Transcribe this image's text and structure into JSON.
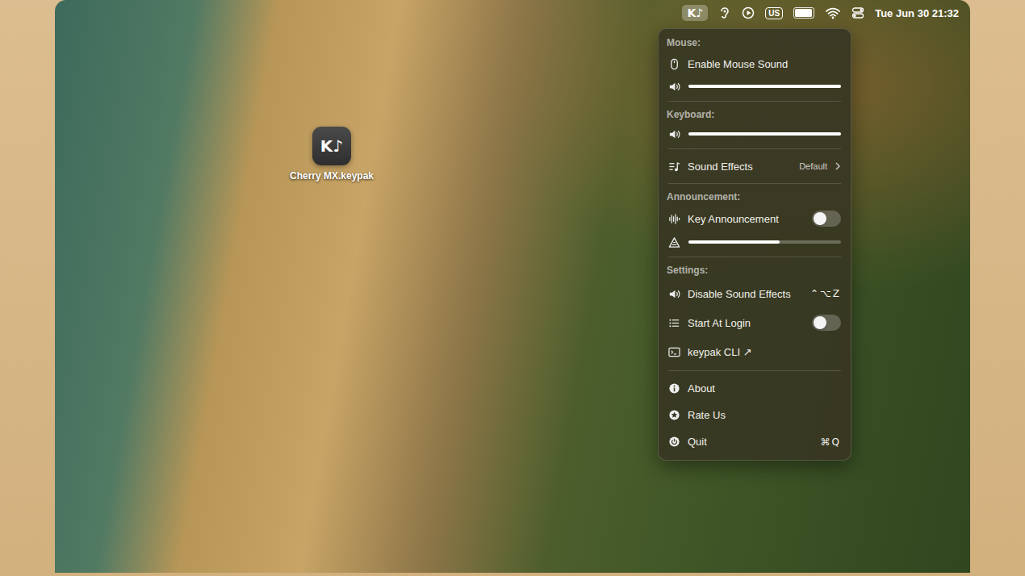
{
  "menubar": {
    "app_icon": {
      "glyph": "K♪",
      "selected": true
    },
    "input_source": "US",
    "battery_level": 0.95,
    "clock": "Tue Jun 30 21:32"
  },
  "desktop_icon": {
    "glyph": "K♪",
    "label": "Cherry MX.keypak"
  },
  "menu": {
    "mouse": {
      "header": "Mouse:",
      "enable": {
        "label": "Enable Mouse Sound",
        "checked": false
      },
      "volume": {
        "level": 1.0
      }
    },
    "keyboard": {
      "header": "Keyboard:",
      "volume": {
        "level": 1.0
      }
    },
    "sound_effects": {
      "label": "Sound Effects",
      "value": "Default"
    },
    "announcement": {
      "header": "Announcement:",
      "key_announcement": {
        "label": "Key Announcement",
        "on": false
      },
      "volume": {
        "level": 0.6
      }
    },
    "settings": {
      "header": "Settings:",
      "disable_effects": {
        "label": "Disable Sound Effects",
        "shortcut": "⌃⌥Z"
      },
      "start_at_login": {
        "label": "Start At Login",
        "on": false
      },
      "cli": {
        "label": "keypak CLI ↗"
      }
    },
    "footer": {
      "about": {
        "label": "About"
      },
      "rate": {
        "label": "Rate Us"
      },
      "quit": {
        "label": "Quit",
        "shortcut": "⌘Q"
      }
    }
  }
}
